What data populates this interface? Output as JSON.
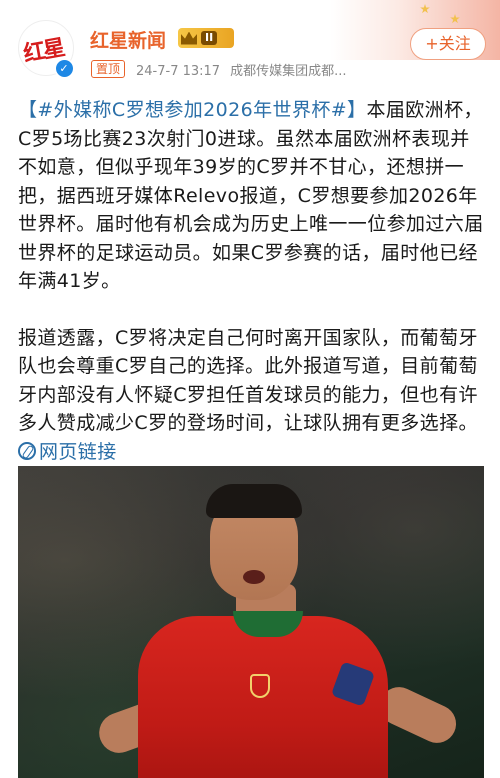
{
  "header": {
    "account_name": "红星新闻",
    "level_label": "II",
    "pin_label": "置顶",
    "timestamp": "24-7-7 13:17",
    "source": "成都传媒集团成都...",
    "follow_label": "+关注",
    "avatar_text": "红星",
    "verified_glyph": "✓"
  },
  "post": {
    "hashtag": "【#外媒称C罗想参加2026年世界杯#】",
    "paragraph1": "本届欧洲杯，C罗5场比赛23次射门0进球。虽然本届欧洲杯表现并不如意，但似乎现年39岁的C罗并不甘心，还想拼一把，据西班牙媒体Relevo报道，C罗想要参加2026年世界杯。届时他有机会成为历史上唯一一位参加过六届世界杯的足球运动员。如果C罗参赛的话，届时他已经年满41岁。",
    "paragraph2": "报道透露，C罗将决定自己何时离开国家队，而葡萄牙队也会尊重C罗自己的选择。此外报道写道，目前葡萄牙内部没有人怀疑C罗担任首发球员的能力，但也有许多人赞成减少C罗的登场时间，让球队拥有更多选择。",
    "web_link_label": "网页链接"
  },
  "colors": {
    "accent": "#e8632b",
    "link": "#2b6fa8",
    "verified": "#1e88e5"
  },
  "icons": [
    "crown-icon",
    "verified-icon",
    "link-icon"
  ]
}
